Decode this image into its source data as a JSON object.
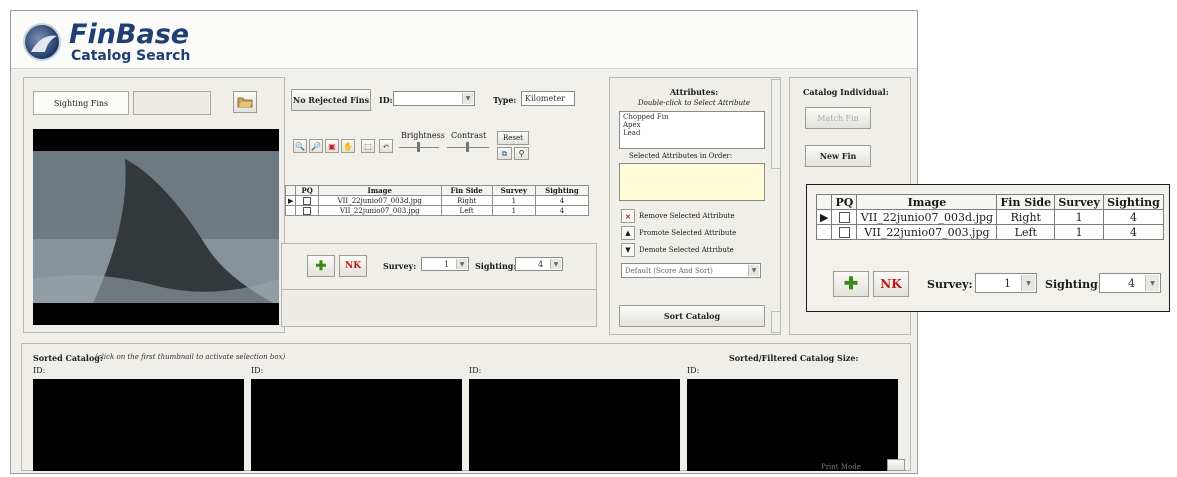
{
  "app": {
    "name": "FinBase",
    "subtitle": "Catalog Search"
  },
  "sighting": {
    "tab_label": "Sighting Fins"
  },
  "toolbar": {
    "no_rejected_label": "No Rejected Fins",
    "id_label": "ID:",
    "id_value": "",
    "type_label": "Type:",
    "type_value": "Kilometer",
    "brightness_label": "Brightness",
    "contrast_label": "Contrast",
    "reset_label": "Reset"
  },
  "fin_table": {
    "columns": [
      "PQ",
      "Image",
      "Fin Side",
      "Survey",
      "Sighting"
    ],
    "rows": [
      {
        "image": "VII_22junio07_003d.jpg",
        "fin_side": "Right",
        "survey": "1",
        "sighting": "4"
      },
      {
        "image": "VII_22junio07_003.jpg",
        "fin_side": "Left",
        "survey": "1",
        "sighting": "4"
      }
    ]
  },
  "survey_controls": {
    "survey_label": "Survey:",
    "survey_value": "1",
    "sighting_label": "Sighting:",
    "sighting_value": "4"
  },
  "attributes": {
    "title": "Attributes:",
    "hint": "Double-click to Select Attribute",
    "items": [
      "Chopped Fin",
      "Apex",
      "Lead"
    ],
    "selected_label": "Selected Attributes in Order:",
    "remove_label": "Remove Selected Attribute",
    "promote_label": "Promote Selected Attribute",
    "demote_label": "Demote Selected Attribute",
    "sort_mode": "Default (Score And Sort)",
    "sort_button": "Sort Catalog"
  },
  "catalog": {
    "title": "Catalog Individual:",
    "match_button": "Match Fin",
    "new_button": "New Fin"
  },
  "sorted": {
    "title": "Sorted Catalog:",
    "hint": "(click on the first thumbnail to activate selection box)",
    "size_label": "Sorted/Filtered Catalog Size:",
    "id_labels": [
      "ID:",
      "ID:",
      "ID:",
      "ID:"
    ]
  },
  "status": {
    "text": "Print Mode"
  },
  "colors": {
    "brand": "#1f3f73",
    "app_bg": "#f0efe9",
    "attr_selected_bg": "#fffbd8"
  }
}
